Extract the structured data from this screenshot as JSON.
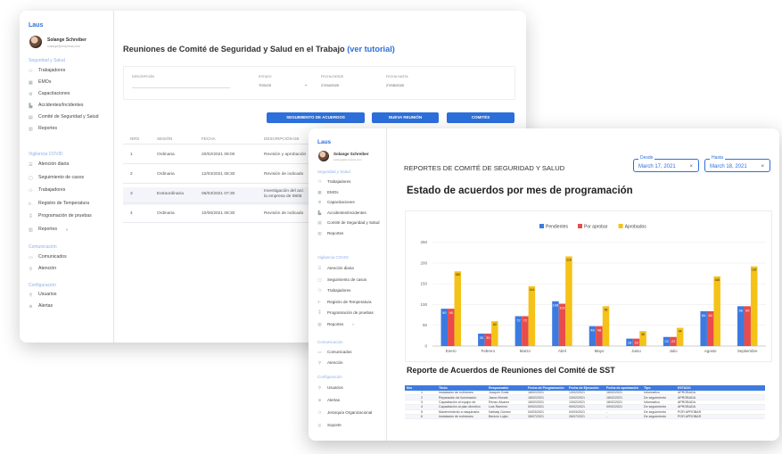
{
  "back": {
    "sidebar": {
      "logo": "Laus",
      "user_name": "Solange Schreiber",
      "user_email": "solange@empresa.com",
      "section_seguridad": "Seguridad y Salud",
      "section_vigilancia": "Vigilancia COVID",
      "section_comunicacion": "Comunicación",
      "section_config": "Configuración",
      "items_seg": [
        {
          "icon": "group-icon",
          "glyph": "⚇",
          "label": "Trabajadores"
        },
        {
          "icon": "grid-icon",
          "glyph": "▦",
          "label": "EMOs"
        },
        {
          "icon": "training-icon",
          "glyph": "⚙",
          "label": "Capacitaciones"
        },
        {
          "icon": "chart-icon",
          "glyph": "▙",
          "label": "Accidentes/Incidentes"
        },
        {
          "icon": "committee-icon",
          "glyph": "▤",
          "label": "Comité de Seguridad y Salud"
        },
        {
          "icon": "report-icon",
          "glyph": "▥",
          "label": "Reportes"
        }
      ],
      "items_vig": [
        {
          "icon": "list-icon",
          "glyph": "☰",
          "label": "Atención diaria"
        },
        {
          "icon": "doc-icon",
          "glyph": "▢",
          "label": "Seguimiento de casos"
        },
        {
          "icon": "group-icon",
          "glyph": "⚇",
          "label": "Trabajadores"
        },
        {
          "icon": "thermometer-icon",
          "glyph": "⊩",
          "label": "Registro de Temperatura"
        },
        {
          "icon": "test-icon",
          "glyph": "⁑",
          "label": "Programación de pruebas"
        },
        {
          "icon": "report-icon",
          "glyph": "▥",
          "label": "Reportes",
          "chevron": "›"
        }
      ],
      "items_com": [
        {
          "icon": "chat-icon",
          "glyph": "▭",
          "label": "Comunicados"
        },
        {
          "icon": "person-icon",
          "glyph": "⚲",
          "label": "Atención"
        }
      ],
      "items_cfg": [
        {
          "icon": "person-icon",
          "glyph": "⚲",
          "label": "Usuarios"
        },
        {
          "icon": "alert-icon",
          "glyph": "⊛",
          "label": "Alertas"
        }
      ]
    },
    "main": {
      "title": "Reuniones de Comité de Seguridad y Salud en el Trabajo",
      "tutorial_link": "(ver tutorial)",
      "filter_desc_label": "DESCRIPCIÓN",
      "filter_estado_label": "ESTADO",
      "filter_estado_value": "TODOS",
      "filter_desde_label": "FECHA DESDE",
      "filter_desde_value": "27/04/2020",
      "filter_hasta_label": "FECHA HASTA",
      "filter_hasta_value": "27/05/2020",
      "btn_seguimiento": "SEGUIMIENTO DE ACUERDOS",
      "btn_nueva": "NUEVA REUNIÓN",
      "btn_comites": "COMITÉS",
      "table_headers": [
        "NRO",
        "SESIÓN",
        "FECHA",
        "DESCRIPCIÓN DE"
      ],
      "rows": [
        {
          "nro": "1",
          "sesion": "Ordinaria",
          "fecha": "20/02/2021 08:00",
          "desc": "Revisión y aprobación",
          "desc2": ""
        },
        {
          "nro": "2",
          "sesion": "Ordinaria",
          "fecha": "12/03/2021 08:30",
          "desc": "Revisión de indicado",
          "desc2": ""
        },
        {
          "nro": "3",
          "sesion": "Extraordinaria",
          "fecha": "06/03/2021 07:30",
          "desc": "Investigación del acc",
          "desc2": "la empresa de 0805"
        },
        {
          "nro": "4",
          "sesion": "Ordinaria",
          "fecha": "10/06/2021 08:30",
          "desc": "Revisión de indicado",
          "desc2": ""
        }
      ]
    }
  },
  "front": {
    "sidebar": {
      "logo": "Laus",
      "user_name": "Solange Schreiber",
      "user_email": "solange@empresa.com",
      "section_seguridad": "Seguridad y Salud",
      "section_vigilancia": "Vigilancia COVID",
      "section_comunicacion": "Comunicación",
      "section_config": "Configuración",
      "items_seg": [
        {
          "icon": "group-icon",
          "glyph": "⚇",
          "label": "Trabajadores"
        },
        {
          "icon": "grid-icon",
          "glyph": "▦",
          "label": "EMOs"
        },
        {
          "icon": "training-icon",
          "glyph": "⚙",
          "label": "Capacitaciones"
        },
        {
          "icon": "chart-icon",
          "glyph": "▙",
          "label": "Accidentes/Incidentes"
        },
        {
          "icon": "committee-icon",
          "glyph": "▤",
          "label": "Comité de Seguridad y Salud"
        },
        {
          "icon": "report-icon",
          "glyph": "▥",
          "label": "Reportes"
        }
      ],
      "items_vig": [
        {
          "icon": "list-icon",
          "glyph": "☰",
          "label": "Atención diaria"
        },
        {
          "icon": "doc-icon",
          "glyph": "▢",
          "label": "Seguimiento de casos"
        },
        {
          "icon": "group-icon",
          "glyph": "⚇",
          "label": "Trabajadores"
        },
        {
          "icon": "thermometer-icon",
          "glyph": "⊩",
          "label": "Registro de Temperatura"
        },
        {
          "icon": "test-icon",
          "glyph": "⁑",
          "label": "Programación de pruebas"
        },
        {
          "icon": "report-icon",
          "glyph": "▥",
          "label": "Reportes",
          "chevron": "›"
        }
      ],
      "items_com": [
        {
          "icon": "chat-icon",
          "glyph": "▭",
          "label": "Comunicados"
        },
        {
          "icon": "person-icon",
          "glyph": "⚲",
          "label": "Atención"
        }
      ],
      "items_cfg": [
        {
          "icon": "person-icon",
          "glyph": "⚲",
          "label": "Usuarios"
        },
        {
          "icon": "alert-icon",
          "glyph": "⊛",
          "label": "Alertas"
        },
        {
          "icon": "hierarchy-icon",
          "glyph": "⚇",
          "label": "Jerarquía Organizacional"
        },
        {
          "icon": "support-icon",
          "glyph": "◎",
          "label": "Soporte"
        }
      ]
    },
    "main": {
      "title": "REPORTES DE COMITÉ DE SEGURIDAD Y SALUD",
      "desde_label": "Desde",
      "desde_value": "March 17, 2021",
      "hasta_label": "Hasta",
      "hasta_value": "March 18, 2021",
      "clear_glyph": "×",
      "chart_title": "Estado de acuerdos por mes de programación",
      "table_title": "Reporte de Acuerdos de Reuniones del Comité de SST",
      "table_headers": [
        "Nro",
        "Titulo",
        "Responsable",
        "Fecha de Programación",
        "Fecha de Ejecución",
        "Fecha de aprobación",
        "Tipo",
        "ESTADO"
      ],
      "table_rows": [
        [
          "1",
          "Instalación de extintores",
          "Joaquín Gratz",
          "18/02/2021",
          "13/02/2021",
          "18/02/2021",
          "Informativo",
          "APROBADA"
        ],
        [
          "2",
          "Reparación de iluminación",
          "Jason Morale",
          "18/02/2021",
          "13/02/2021",
          "18/02/2021",
          "De seguimiento",
          "APROBADA"
        ],
        [
          "3",
          "Capacitación al equipo de",
          "Renzo Alvarez",
          "18/02/2021",
          "13/02/2021",
          "18/02/2021",
          "Informativo",
          "APROBADA"
        ],
        [
          "4",
          "Capacitación al plan directivo",
          "Luis Ramírez",
          "09/02/2021",
          "09/02/2021",
          "09/02/2021",
          "De seguimiento",
          "APROBADA"
        ],
        [
          "5",
          "Mantenimiento a maquinaria",
          "Nathaly Gómez",
          "04/03/2021",
          "04/03/2021",
          "-",
          "De seguimiento",
          "POR APROBAR"
        ],
        [
          "6",
          "Instalación de extintores",
          "Benicio Luján",
          "28/07/2021",
          "28/07/2021",
          "-",
          "De seguimiento",
          "POR APROBAR"
        ]
      ]
    }
  },
  "chart_data": {
    "type": "bar",
    "title": "Estado de acuerdos por mes de programación",
    "categories": [
      "Enero",
      "Febrero",
      "Marzo",
      "Abril",
      "Mayo",
      "Junio",
      "Julio",
      "Agosto",
      "Septiembre"
    ],
    "series": [
      {
        "name": "Pendientes",
        "color": "#3d7ae0",
        "values": [
          90,
          30,
          72,
          108,
          48,
          18,
          22,
          84,
          96
        ]
      },
      {
        "name": "Por aprobar",
        "color": "#e84c4c",
        "values": [
          90,
          30,
          72,
          102,
          48,
          18,
          22,
          84,
          96
        ]
      },
      {
        "name": "Aprobados",
        "color": "#f5c218",
        "values": [
          180,
          60,
          144,
          216,
          96,
          36,
          44,
          168,
          192
        ]
      }
    ],
    "ylim": [
      0,
      260
    ],
    "yticks": [
      0,
      50,
      100,
      150,
      200,
      250
    ],
    "legend": "top-center",
    "grid": true
  }
}
